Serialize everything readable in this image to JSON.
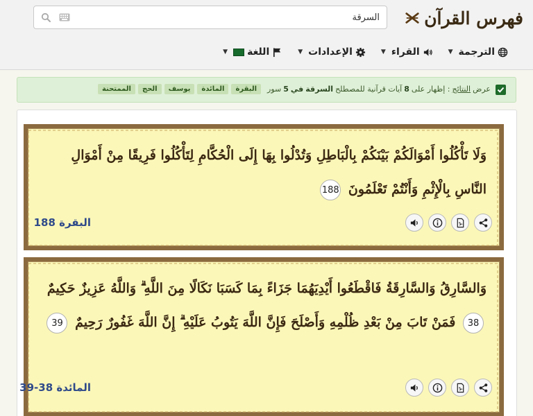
{
  "app": {
    "title": "فهرس القرآن"
  },
  "search": {
    "value": "السرقة",
    "placeholder": ""
  },
  "nav": [
    {
      "label": "الترجمة",
      "icon": "globe-icon"
    },
    {
      "label": "القراء",
      "icon": "speaker-icon"
    },
    {
      "label": "الإعدادات",
      "icon": "gear-icon"
    },
    {
      "label": "اللغة",
      "icon": "flag-icon"
    }
  ],
  "results": {
    "prefix": "عرض",
    "link": "النتائج",
    "text_a": ": إظهار على",
    "count": "8",
    "text_b": "آيات قرآنية للمصطلح",
    "term": "السرقة",
    "text_c": "في",
    "surah_count": "5",
    "text_d": "سور",
    "tags": [
      "البقرة",
      "المائدة",
      "يوسف",
      "الحج",
      "الممتحنة"
    ]
  },
  "verses": [
    {
      "segments": [
        {
          "t": "وَلَا تَأْكُلُوا أَمْوَالَكُمْ بَيْنَكُمْ بِالْبَاطِلِ وَتُدْلُوا بِهَا إِلَى الْحُكَّامِ لِتَأْكُلُوا فَرِيقًا مِنْ أَمْوَالِ النَّاسِ بِالْإِثْمِ وَأَنْتُمْ تَعْلَمُونَ"
        },
        {
          "n": "188"
        }
      ],
      "ref": "البقرة 188"
    },
    {
      "segments": [
        {
          "t": "وَالسَّارِقُ وَالسَّارِقَةُ فَاقْطَعُوا أَيْدِيَهُمَا جَزَاءً بِمَا كَسَبَا نَكَالًا مِنَ اللَّهِ ۗ وَاللَّهُ عَزِيزٌ حَكِيمٌ"
        },
        {
          "n": "38"
        },
        {
          "t": "فَمَنْ تَابَ مِنْ بَعْدِ ظُلْمِهِ وَأَصْلَحَ فَإِنَّ اللَّهَ يَتُوبُ عَلَيْهِ ۗ إِنَّ اللَّهَ غَفُورٌ رَحِيمٌ"
        },
        {
          "n": "39"
        }
      ],
      "ref": "المائدة 38-39"
    }
  ],
  "colors": {
    "accent": "#2f4a8a",
    "verse_bg": "#fbf7b8",
    "frame": "#8b6a3f"
  }
}
